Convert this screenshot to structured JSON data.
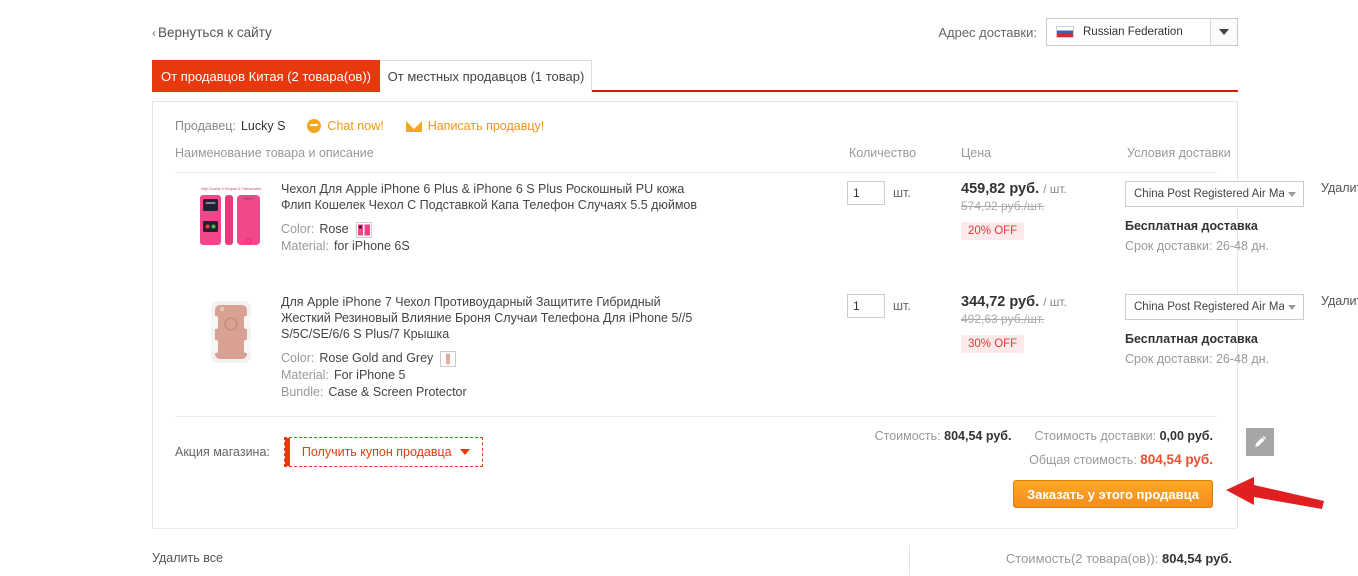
{
  "header": {
    "back_link": "Вернуться к сайту",
    "back_chevron": "‹",
    "address_label": "Адрес доставки:",
    "address_value": "Russian Federation",
    "flag_icon": "russian-flag-icon",
    "dropdown_icon": "chevron-down-icon"
  },
  "tabs": [
    {
      "label": "От продавцов Китая (2 товара(ов))",
      "active": true
    },
    {
      "label": "От местных продавцов (1 товар)",
      "active": false
    }
  ],
  "seller": {
    "label": "Продавец:",
    "name": "Lucky S",
    "chat_label": "Chat now!",
    "chat_icon": "chat-bubble-icon",
    "mail_label": "Написать продавцу!",
    "mail_icon": "envelope-icon"
  },
  "table_headers": {
    "name": "Наименование товара и описание",
    "quantity": "Количество",
    "price": "Цена",
    "shipping": "Условия доставки"
  },
  "products": [
    {
      "thumb_icon": "phone-case-rose-thumbnail",
      "title": "Чехол Для Apple iPhone 6 Plus & iPhone 6 S Plus Роскошный PU кожа Флип Кошелек Чехол С Подставкой Капа Телефон Случаях 5.5 дюймов",
      "attributes": [
        {
          "key": "Color:",
          "value": "Rose",
          "swatch": "rose-swatch-icon"
        },
        {
          "key": "Material:",
          "value": "for iPhone 6S"
        }
      ],
      "qty": "1",
      "qty_unit": "шт.",
      "price": "459,82 руб.",
      "price_unit": "/ шт.",
      "price_old": "574,92 руб./шт.",
      "discount": "20% OFF",
      "shipping_method": "China Post Registered Air Mail",
      "shipping_free": "Бесплатная доставка",
      "shipping_time": "Срок доставки: 26-48 дн.",
      "delete_label": "Удалить"
    },
    {
      "thumb_icon": "phone-case-rose-gold-thumbnail",
      "title": "Для Apple iPhone 7 Чехол Противоударный Защитите Гибридный Жесткий Резиновый Влияние Броня Случаи Телефона Для iPhone 5//5 S/5C/SE/6/6 S Plus/7 Крышка",
      "attributes": [
        {
          "key": "Color:",
          "value": "Rose Gold and Grey",
          "swatch": "rose-gold-swatch-icon"
        },
        {
          "key": "Material:",
          "value": "For iPhone 5"
        },
        {
          "key": "Bundle:",
          "value": "Case & Screen Protector"
        }
      ],
      "qty": "1",
      "qty_unit": "шт.",
      "price": "344,72 руб.",
      "price_unit": "/ шт.",
      "price_old": "492,63 руб./шт.",
      "discount": "30% OFF",
      "shipping_method": "China Post Registered Air Mail",
      "shipping_free": "Бесплатная доставка",
      "shipping_time": "Срок доставки: 26-48 дн.",
      "delete_label": "Удалить"
    }
  ],
  "coupon": {
    "label": "Акция магазина:",
    "button_text": "Получить купон продавца",
    "caret_icon": "chevron-down-icon"
  },
  "totals": {
    "subtotal_label": "Стоимость:",
    "subtotal_value": "804,54 руб.",
    "shipping_label": "Стоимость доставки:",
    "shipping_value": "0,00 руб.",
    "grand_label": "Общая стоимость:",
    "grand_value": "804,54 руб."
  },
  "order_button": "Заказать у этого продавца",
  "edit_icon": "pencil-edit-icon",
  "annotation_arrow": "red-arrow-pointer",
  "footer": {
    "delete_all": "Удалить все",
    "total_label": "Стоимость(2 товара(ов)):",
    "total_value": "804,54 руб."
  },
  "colors": {
    "accent_red": "#e8380d",
    "tab_border_red": "#cc2200",
    "order_orange": "#f68b1e",
    "grand_total_orange": "#ee4d2d",
    "link_orange": "#f0951b",
    "discount_red": "#e4393c",
    "annotation_red": "#e02020"
  }
}
